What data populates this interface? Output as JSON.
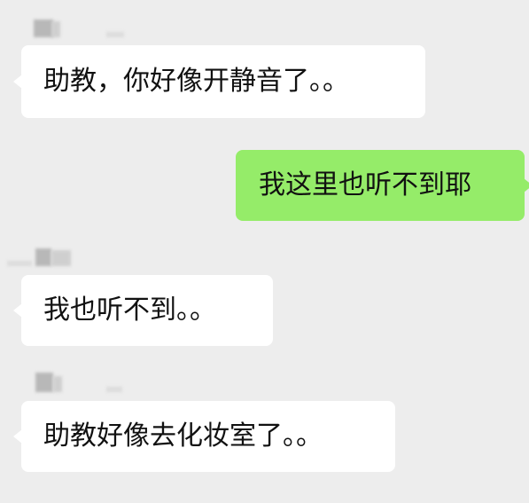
{
  "messages": [
    {
      "side": "left",
      "text": "助教，你好像开静音了。。"
    },
    {
      "side": "right",
      "text": "我这里也听不到耶"
    },
    {
      "side": "left",
      "text": "我也听不到。。"
    },
    {
      "side": "left",
      "text": "助教好像去化妆室了。。"
    }
  ],
  "colors": {
    "background": "#ededed",
    "incoming_bubble": "#ffffff",
    "outgoing_bubble": "#95ec69",
    "text": "#111111"
  }
}
